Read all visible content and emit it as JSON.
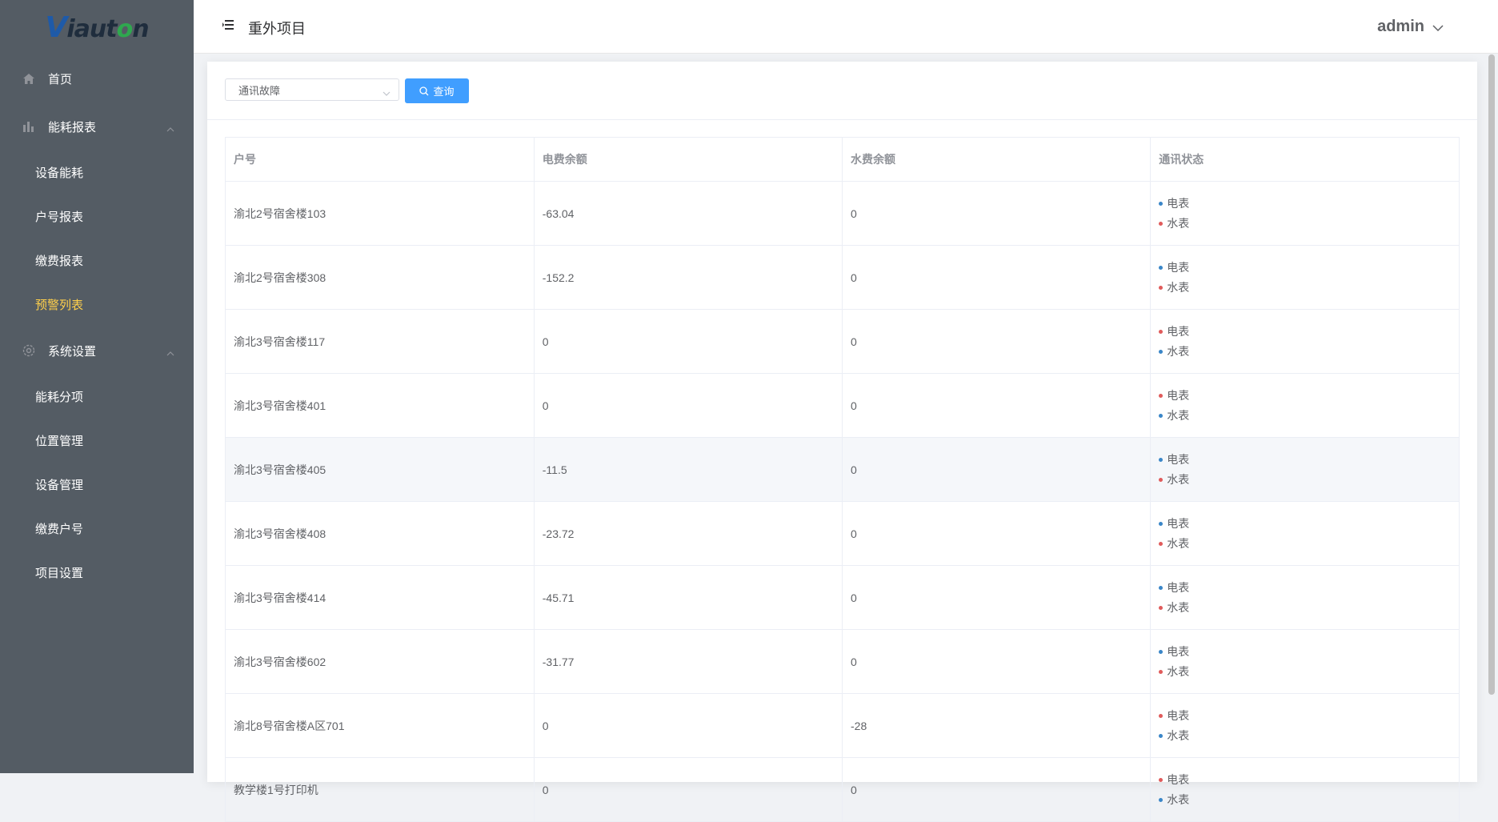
{
  "logo": {
    "text": "Viauton"
  },
  "sidebar": {
    "home": "首页",
    "group1": {
      "label": "能耗报表",
      "items": [
        "设备能耗",
        "户号报表",
        "缴费报表",
        "预警列表"
      ]
    },
    "group2": {
      "label": "系统设置",
      "items": [
        "能耗分项",
        "位置管理",
        "设备管理",
        "缴费户号",
        "项目设置"
      ]
    }
  },
  "header": {
    "project": "重外项目",
    "user": "admin"
  },
  "filter": {
    "select_value": "通讯故障",
    "query_label": "查询"
  },
  "table": {
    "columns": [
      "户号",
      "电费余额",
      "水费余额",
      "通讯状态"
    ],
    "meters": [
      "电表",
      "水表"
    ],
    "rows": [
      {
        "account": "渝北2号宿舍楼103",
        "elec": "-63.04",
        "water": "0",
        "status": [
          "#3a86c8",
          "#e05b5b"
        ]
      },
      {
        "account": "渝北2号宿舍楼308",
        "elec": "-152.2",
        "water": "0",
        "status": [
          "#3a86c8",
          "#e05b5b"
        ]
      },
      {
        "account": "渝北3号宿舍楼117",
        "elec": "0",
        "water": "0",
        "status": [
          "#e05b5b",
          "#3a86c8"
        ]
      },
      {
        "account": "渝北3号宿舍楼401",
        "elec": "0",
        "water": "0",
        "status": [
          "#e05b5b",
          "#3a86c8"
        ]
      },
      {
        "account": "渝北3号宿舍楼405",
        "elec": "-11.5",
        "water": "0",
        "status": [
          "#3a86c8",
          "#e05b5b"
        ]
      },
      {
        "account": "渝北3号宿舍楼408",
        "elec": "-23.72",
        "water": "0",
        "status": [
          "#3a86c8",
          "#e05b5b"
        ]
      },
      {
        "account": "渝北3号宿舍楼414",
        "elec": "-45.71",
        "water": "0",
        "status": [
          "#3a86c8",
          "#e05b5b"
        ]
      },
      {
        "account": "渝北3号宿舍楼602",
        "elec": "-31.77",
        "water": "0",
        "status": [
          "#3a86c8",
          "#e05b5b"
        ]
      },
      {
        "account": "渝北8号宿舍楼A区701",
        "elec": "0",
        "water": "-28",
        "status": [
          "#e05b5b",
          "#3a86c8"
        ]
      },
      {
        "account": "教学楼1号打印机",
        "elec": "0",
        "water": "0",
        "status": [
          "#e05b5b",
          "#3a86c8"
        ]
      }
    ]
  },
  "colors": {
    "sidebar_bg": "#545c64",
    "active": "#ffd04b",
    "primary": "#409eff",
    "online": "#3a86c8",
    "offline": "#e05b5b"
  }
}
